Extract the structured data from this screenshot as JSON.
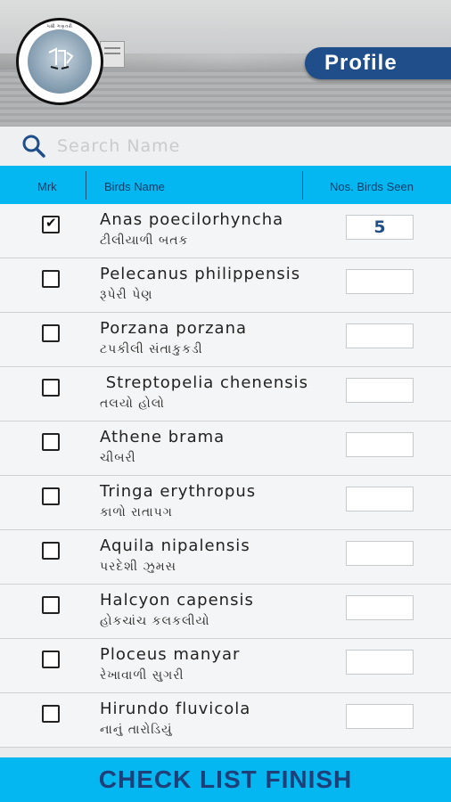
{
  "header": {
    "logo_text": "પક્ષી ગણતરી",
    "profile_label": "Profile"
  },
  "search": {
    "placeholder": "Search Name",
    "icon": "search-icon"
  },
  "table": {
    "columns": [
      "Mrk",
      "Birds Name",
      "Nos. Birds Seen"
    ],
    "rows": [
      {
        "checked": true,
        "scientific": "Anas poecilorhyncha",
        "gujarati": "ટીલીયાળી બતક",
        "count": "5"
      },
      {
        "checked": false,
        "scientific": "Pelecanus philippensis",
        "gujarati": "રૂપેરી પેણ",
        "count": ""
      },
      {
        "checked": false,
        "scientific": "Porzana porzana",
        "gujarati": "ટપકીલી સંતાકુકડી",
        "count": ""
      },
      {
        "checked": false,
        "scientific": " Streptopelia chenensis",
        "gujarati": "તલયો હોલો",
        "count": ""
      },
      {
        "checked": false,
        "scientific": "Athene brama",
        "gujarati": "ચીબરી",
        "count": ""
      },
      {
        "checked": false,
        "scientific": "Tringa erythropus",
        "gujarati": "કાળો રાતાપગ",
        "count": ""
      },
      {
        "checked": false,
        "scientific": "Aquila nipalensis",
        "gujarati": "પરદેશી ઝુમસ",
        "count": ""
      },
      {
        "checked": false,
        "scientific": "Halcyon capensis",
        "gujarati": "હોકચાંચ કલકલીયો",
        "count": ""
      },
      {
        "checked": false,
        "scientific": "Ploceus manyar",
        "gujarati": "રેખાવાળી સુગરી",
        "count": ""
      },
      {
        "checked": false,
        "scientific": "Hirundo fluvicola",
        "gujarati": "નાનું તારોડિયું",
        "count": ""
      }
    ]
  },
  "footer": {
    "finish_label": "CHECK LIST FINISH"
  },
  "colors": {
    "accent": "#05b7f0",
    "brand": "#1f4e8a"
  }
}
